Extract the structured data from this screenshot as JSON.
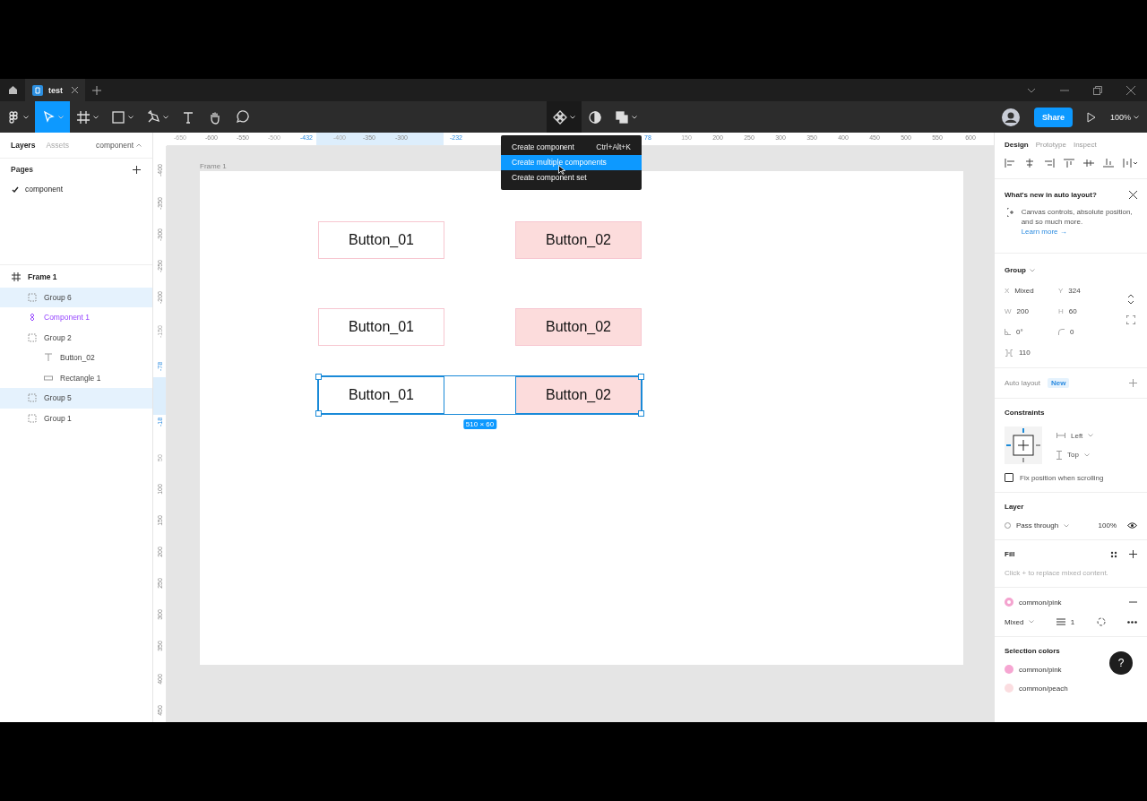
{
  "tabs": [
    {
      "label": "test",
      "selected": true
    }
  ],
  "tools": [
    {
      "kind": "main-menu",
      "selected": false
    },
    {
      "kind": "move",
      "selected": true
    },
    {
      "kind": "frame",
      "selected": false
    },
    {
      "kind": "shape",
      "selected": false
    },
    {
      "kind": "pen",
      "selected": false
    },
    {
      "kind": "text",
      "selected": false
    },
    {
      "kind": "hand",
      "selected": false
    },
    {
      "kind": "comment",
      "selected": false
    }
  ],
  "center_tools": [
    {
      "kind": "component",
      "selected": true
    },
    {
      "kind": "mask",
      "selected": false
    },
    {
      "kind": "boolean",
      "selected": false
    }
  ],
  "share_button": "Share",
  "zoom": "100%",
  "left_panel": {
    "tabs": [
      {
        "label": "Layers",
        "selected": true
      },
      {
        "label": "Assets",
        "selected": false
      }
    ],
    "page_switch": "component",
    "pages_title": "Pages",
    "pages": [
      {
        "label": "component",
        "selected": true
      }
    ],
    "layers": [
      {
        "label": "Frame 1",
        "kind": "frame",
        "selected": false,
        "children": [
          {
            "label": "Group 6",
            "kind": "group",
            "selected": true
          },
          {
            "label": "Component 1",
            "kind": "component",
            "selected": false
          },
          {
            "label": "Group 2",
            "kind": "group",
            "selected": false,
            "children": [
              {
                "label": "Button_02",
                "kind": "text",
                "selected": false
              },
              {
                "label": "Rectangle 1",
                "kind": "rectangle",
                "selected": false
              }
            ]
          },
          {
            "label": "Group 5",
            "kind": "group",
            "selected": true
          },
          {
            "label": "Group 1",
            "kind": "group",
            "selected": false
          }
        ]
      }
    ]
  },
  "rulers": {
    "horizontal": [
      {
        "label": "-650",
        "kind": "faint"
      },
      {
        "label": "-600",
        "kind": "normal"
      },
      {
        "label": "-550",
        "kind": "normal"
      },
      {
        "label": "-500",
        "kind": "faint"
      },
      {
        "label": "-432",
        "kind": "selected"
      },
      {
        "label": "-400",
        "kind": "faint"
      },
      {
        "label": "-350",
        "kind": "normal"
      },
      {
        "label": "-300",
        "kind": "normal"
      },
      {
        "label": "-232",
        "kind": "selected"
      },
      {
        "label": "78",
        "kind": "selected"
      },
      {
        "label": "150",
        "kind": "faint"
      },
      {
        "label": "200",
        "kind": "normal"
      },
      {
        "label": "250",
        "kind": "normal"
      },
      {
        "label": "300",
        "kind": "normal"
      },
      {
        "label": "350",
        "kind": "normal"
      },
      {
        "label": "400",
        "kind": "normal"
      },
      {
        "label": "450",
        "kind": "normal"
      },
      {
        "label": "500",
        "kind": "normal"
      },
      {
        "label": "550",
        "kind": "normal"
      },
      {
        "label": "600",
        "kind": "normal"
      }
    ],
    "vertical": [
      {
        "label": "-400",
        "kind": "normal"
      },
      {
        "label": "-350",
        "kind": "normal"
      },
      {
        "label": "-300",
        "kind": "normal"
      },
      {
        "label": "-250",
        "kind": "normal"
      },
      {
        "label": "-200",
        "kind": "normal"
      },
      {
        "label": "-150",
        "kind": "faint"
      },
      {
        "label": "-78",
        "kind": "selected"
      },
      {
        "label": "-18",
        "kind": "selected"
      },
      {
        "label": "50",
        "kind": "faint"
      },
      {
        "label": "100",
        "kind": "normal"
      },
      {
        "label": "150",
        "kind": "normal"
      },
      {
        "label": "200",
        "kind": "normal"
      },
      {
        "label": "250",
        "kind": "normal"
      },
      {
        "label": "300",
        "kind": "normal"
      },
      {
        "label": "350",
        "kind": "normal"
      },
      {
        "label": "400",
        "kind": "normal"
      },
      {
        "label": "450",
        "kind": "normal"
      }
    ]
  },
  "canvas": {
    "frame_label": "Frame 1",
    "rows": [
      {
        "selected": false,
        "buttons": [
          {
            "label": "Button_01",
            "kind": "outline"
          },
          {
            "label": "Button_02",
            "kind": "filled"
          }
        ]
      },
      {
        "selected": false,
        "buttons": [
          {
            "label": "Button_01",
            "kind": "outline"
          },
          {
            "label": "Button_02",
            "kind": "filled"
          }
        ]
      },
      {
        "selected": true,
        "size": "510 × 60",
        "buttons": [
          {
            "label": "Button_01",
            "kind": "outline"
          },
          {
            "label": "Button_02",
            "kind": "filled"
          }
        ]
      }
    ]
  },
  "menu": {
    "items": [
      {
        "label": "Create component",
        "shortcut": "Ctrl+Alt+K",
        "selected": false
      },
      {
        "label": "Create multiple components",
        "selected": true
      },
      {
        "label": "Create component set",
        "selected": false
      }
    ]
  },
  "right_panel": {
    "tabs": [
      {
        "label": "Design",
        "selected": true
      },
      {
        "label": "Prototype",
        "selected": false
      },
      {
        "label": "Inspect",
        "selected": false
      }
    ],
    "notice": {
      "title": "What's new in auto layout?",
      "body": "Canvas controls, absolute position, and so much more.",
      "link": "Learn more →"
    },
    "group": {
      "title": "Group",
      "fields": [
        {
          "label": "X",
          "value": "Mixed",
          "kind": "text"
        },
        {
          "label": "Y",
          "value": "324",
          "kind": "text"
        },
        {
          "label": "W",
          "value": "200",
          "kind": "text"
        },
        {
          "label": "H",
          "value": "60",
          "kind": "text"
        },
        {
          "value": "0°",
          "kind": "rotation"
        },
        {
          "value": "0",
          "kind": "radius"
        }
      ],
      "spacing": "110"
    },
    "auto_layout": {
      "title": "Auto layout",
      "badge": "New"
    },
    "constraints": {
      "title": "Constraints",
      "horizontal": "Left",
      "vertical": "Top",
      "fix_label": "Fix position when scrolling",
      "fix_checked": false
    },
    "layer": {
      "title": "Layer",
      "blend": "Pass through",
      "opacity": "100%"
    },
    "fill": {
      "title": "Fill",
      "hint": "Click + to replace mixed content.",
      "swatch": {
        "name": "common/pink",
        "color": "#f4a3cf"
      },
      "mode": "Mixed",
      "count": "1"
    },
    "selection_colors": {
      "title": "Selection colors",
      "colors": [
        {
          "name": "common/pink",
          "color": "#f6a6d2"
        },
        {
          "name": "common/peach",
          "color": "#fbdde0"
        }
      ]
    }
  },
  "help": "?"
}
